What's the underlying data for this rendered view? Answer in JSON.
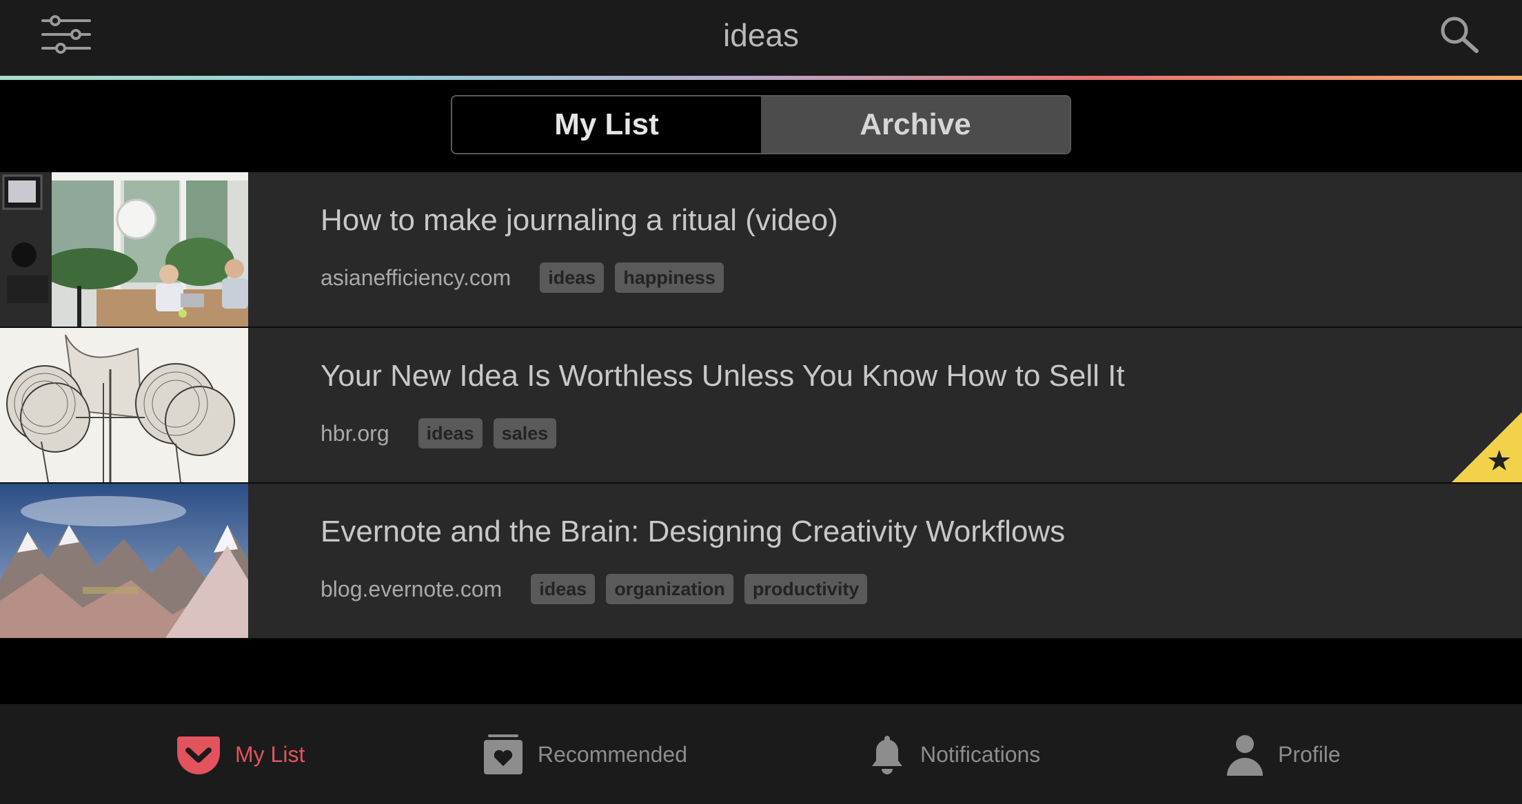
{
  "header": {
    "title": "ideas",
    "filter_icon": "sliders-icon",
    "search_icon": "search-icon"
  },
  "segments": {
    "my_list": "My List",
    "archive": "Archive",
    "selected": "My List"
  },
  "items": [
    {
      "title": "How to make journaling a ritual (video)",
      "domain": "asianefficiency.com",
      "tags": [
        "ideas",
        "happiness"
      ],
      "favorite": false
    },
    {
      "title": "Your New Idea Is Worthless Unless You Know How to Sell It",
      "domain": "hbr.org",
      "tags": [
        "ideas",
        "sales"
      ],
      "favorite": true
    },
    {
      "title": "Evernote and the Brain: Designing Creativity Workflows",
      "domain": "blog.evernote.com",
      "tags": [
        "ideas",
        "organization",
        "productivity"
      ],
      "favorite": false
    }
  ],
  "bottom_nav": {
    "my_list": "My List",
    "recommended": "Recommended",
    "notifications": "Notifications",
    "profile": "Profile",
    "active": "My List"
  },
  "colors": {
    "accent": "#e2535e",
    "favorite": "#f2d24a",
    "background": "#000000",
    "row": "#29292a"
  }
}
